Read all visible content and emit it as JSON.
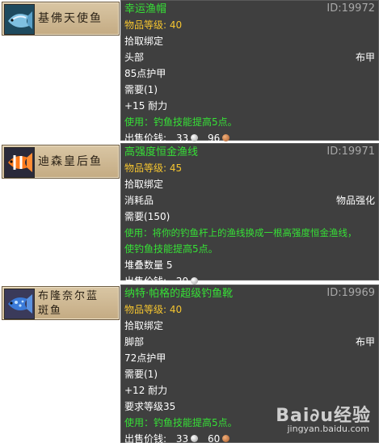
{
  "items": [
    {
      "card_name": "基佛天使鱼",
      "tooltip": {
        "title": "幸运渔帽",
        "id": "ID:19972",
        "item_level_label": "物品等级: 40",
        "bind": "拾取绑定",
        "slot": "头部",
        "slot_type": "布甲",
        "armor": "85点护甲",
        "requires": "需要(1)",
        "stat": "+15 耐力",
        "use": "使用：钓鱼技能提高5点。",
        "sell_label": "出售价钱:",
        "silver": "33",
        "copper": "96"
      }
    },
    {
      "card_name": "迪森皇后鱼",
      "tooltip": {
        "title": "高强度恒金渔线",
        "id": "ID:19971",
        "item_level_label": "物品等级: 45",
        "bind": "拾取绑定",
        "slot": "消耗品",
        "slot_type": "物品强化",
        "requires": "需要(150)",
        "use_line1": "使用：将你的钓鱼杆上的渔线换成一根高强度恒金渔线，",
        "use_line2": "使钓鱼技能提高5点。",
        "stack": "堆叠数量 5",
        "sell_label": "出售价钱:",
        "silver": "20"
      }
    },
    {
      "card_name_line1": "布隆奈尔蓝",
      "card_name_line2": "斑鱼",
      "tooltip": {
        "title": "纳特·帕格的超级钓鱼靴",
        "id": "ID:19969",
        "item_level_label": "物品等级: 40",
        "bind": "拾取绑定",
        "slot": "脚部",
        "slot_type": "布甲",
        "armor": "72点护甲",
        "requires": "需要(1)",
        "stat": "+12 耐力",
        "req_level": "要求等级35",
        "use": "使用：钓鱼技能提高5点。",
        "sell_label": "出售价钱:",
        "silver": "33",
        "copper": "60"
      }
    }
  ],
  "watermark": {
    "logo": "Bai∂u经验",
    "url": "jingyan.baidu.com"
  },
  "colors": {
    "tooltip_bg": "#3f3f3f",
    "title_green": "#36e036",
    "level_yellow": "#f4c430",
    "id_gray": "#a8a8a8"
  }
}
